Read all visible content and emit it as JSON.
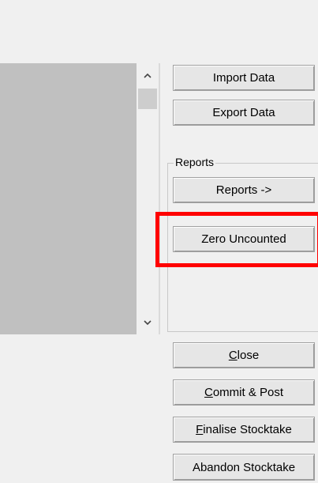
{
  "buttons": {
    "import_data": "Import Data",
    "export_data": "Export Data",
    "reports": "Reports ->",
    "zero_uncounted": "Zero Uncounted",
    "close_first": "C",
    "close_rest": "lose",
    "commit_first": "C",
    "commit_rest": "ommit & Post",
    "finalise_first": "F",
    "finalise_rest": "inalise Stocktake",
    "abandon": "Abandon Stocktake"
  },
  "reports_group": {
    "label": "Reports"
  },
  "colors": {
    "highlight": "#ff0000",
    "list_background": "#c0c0c0"
  }
}
